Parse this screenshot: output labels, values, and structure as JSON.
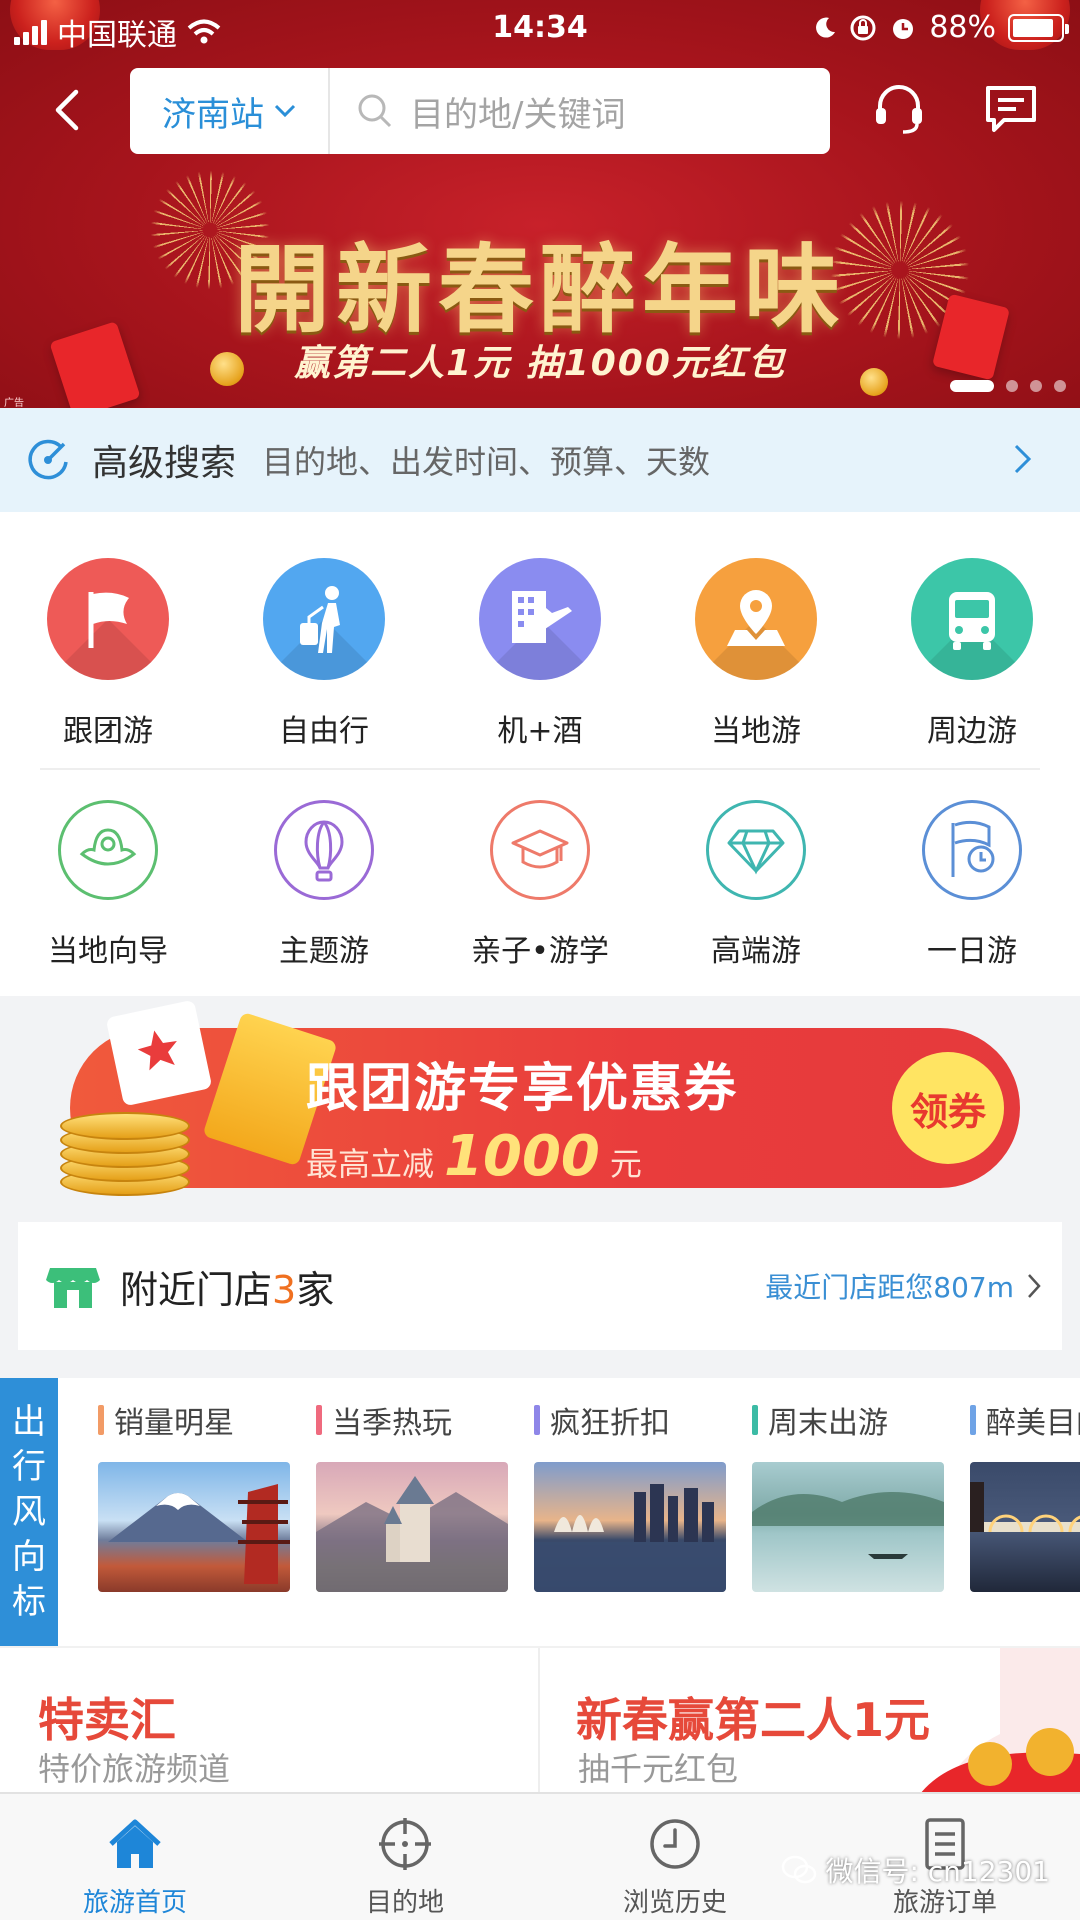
{
  "statusbar": {
    "carrier": "中国联通",
    "time": "14:34",
    "battery_pct": "88%",
    "battery_level": 0.88
  },
  "header": {
    "city": "济南站",
    "search_placeholder": "目的地/关键词"
  },
  "banner": {
    "title": "開新春醉年味",
    "subtitle": "赢第二人1元 抽1000元红包",
    "ad_tag": "广告",
    "slides_total": 4,
    "slide_active": 1
  },
  "advanced_search": {
    "title": "高级搜索",
    "hint": "目的地、出发时间、预算、天数"
  },
  "categories_row1": [
    {
      "label": "跟团游",
      "icon": "flag-icon",
      "color": "#ee5a57"
    },
    {
      "label": "自由行",
      "icon": "traveler-icon",
      "color": "#52a7f0"
    },
    {
      "label": "机+酒",
      "icon": "plane-hotel-icon",
      "color": "#8a8cf0"
    },
    {
      "label": "当地游",
      "icon": "location-pin-icon",
      "color": "#f6a03e"
    },
    {
      "label": "周边游",
      "icon": "bus-icon",
      "color": "#3cc6a8"
    }
  ],
  "categories_row2": [
    {
      "label": "当地向导",
      "icon": "guide-hat-icon",
      "color": "#5cbf70"
    },
    {
      "label": "主题游",
      "icon": "hot-air-balloon-icon",
      "color": "#9a6ad6"
    },
    {
      "label": "亲子•游学",
      "icon": "graduation-cap-icon",
      "color": "#ee7a6a"
    },
    {
      "label": "高端游",
      "icon": "diamond-icon",
      "color": "#3fb6b0"
    },
    {
      "label": "一日游",
      "icon": "flag-clock-icon",
      "color": "#5b8fd6"
    }
  ],
  "coupon": {
    "title": "跟团游专享优惠券",
    "sub_prefix": "最高立减",
    "amount": "1000",
    "unit": "元",
    "button": "领券"
  },
  "nearby": {
    "title_prefix": "附近门店",
    "count": "3",
    "title_suffix": "家",
    "distance_text": "最近门店距您807m"
  },
  "trend": {
    "tag": [
      "出",
      "行",
      "风",
      "向",
      "标"
    ],
    "columns": [
      {
        "label": "销量明星",
        "bar": "#f29b66",
        "scene": "mt-fuji"
      },
      {
        "label": "当季热玩",
        "bar": "#ef6a7e",
        "scene": "castle"
      },
      {
        "label": "疯狂折扣",
        "bar": "#8e86e8",
        "scene": "city-skyline"
      },
      {
        "label": "周末出游",
        "bar": "#3cbba5",
        "scene": "lake-boat"
      },
      {
        "label": "醉美目的",
        "bar": "#6fa3e6",
        "scene": "bridge-night"
      }
    ]
  },
  "promo": {
    "left_title": "特卖汇",
    "left_sub": "特价旅游频道",
    "right_title": "新春赢第二人1元",
    "right_sub": "抽千元红包"
  },
  "tabbar": [
    {
      "label": "旅游首页",
      "icon": "home-icon",
      "active": true
    },
    {
      "label": "目的地",
      "icon": "crosshair-icon",
      "active": false
    },
    {
      "label": "浏览历史",
      "icon": "clock-icon",
      "active": false
    },
    {
      "label": "旅游订单",
      "icon": "order-list-icon",
      "active": false
    }
  ],
  "watermark": "微信号: cn12301",
  "colors": {
    "brand_blue": "#2e8fd8",
    "banner_red": "#a6141c",
    "coupon_red": "#e93c3c",
    "accent_orange": "#f07020"
  }
}
